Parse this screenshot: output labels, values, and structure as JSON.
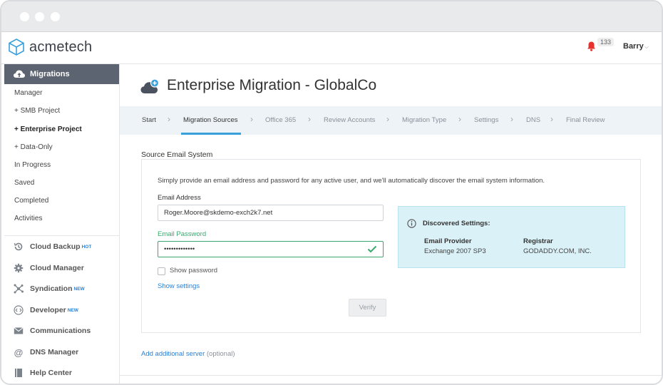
{
  "app": {
    "brand": "acmetech",
    "notification_count": "133",
    "user_name": "Barry"
  },
  "sidebar": {
    "header": "Migrations",
    "sub_items": [
      {
        "label": "Manager",
        "bold": false
      },
      {
        "label": "+ SMB Project",
        "bold": false
      },
      {
        "label": "+ Enterprise Project",
        "bold": true
      },
      {
        "label": "+ Data-Only",
        "bold": false
      },
      {
        "label": "In Progress",
        "bold": false
      },
      {
        "label": "Saved",
        "bold": false
      },
      {
        "label": "Completed",
        "bold": false
      },
      {
        "label": "Activities",
        "bold": false
      }
    ],
    "items": [
      {
        "label": "Cloud Backup",
        "tag": "HOT",
        "icon": "history-icon"
      },
      {
        "label": "Cloud Manager",
        "tag": "",
        "icon": "gear-icon"
      },
      {
        "label": "Syndication",
        "tag": "NEW",
        "icon": "network-icon"
      },
      {
        "label": "Developer",
        "tag": "NEW",
        "icon": "code-icon"
      },
      {
        "label": "Communications",
        "tag": "",
        "icon": "envelope-icon"
      },
      {
        "label": "DNS Manager",
        "tag": "",
        "icon": "at-icon"
      },
      {
        "label": "Help Center",
        "tag": "",
        "icon": "book-icon"
      }
    ]
  },
  "main": {
    "title": "Enterprise Migration - GlobalCo",
    "steps": [
      "Start",
      "Migration Sources",
      "Office 365",
      "Review Accounts",
      "Migration Type",
      "Settings",
      "DNS",
      "Final Review"
    ],
    "active_step": 1,
    "section_title": "Source Email System",
    "intro": "Simply provide an email address and password for any active user, and we'll automatically discover the email system information.",
    "email_label": "Email Address",
    "email_value": "Roger.Moore@skdemo-exch2k7.net",
    "password_label": "Email Password",
    "password_value": "•••••••••••••",
    "show_password": "Show password",
    "show_settings": "Show settings",
    "verify": "Verify",
    "discovered": {
      "title": "Discovered Settings:",
      "provider_label": "Email Provider",
      "provider_value": "Exchange 2007 SP3",
      "registrar_label": "Registrar",
      "registrar_value": "GODADDY.COM, INC."
    },
    "add_server": "Add additional server",
    "add_server_optional": "(optional)"
  },
  "colors": {
    "accent": "#3aa0dc",
    "link": "#2a7fd4",
    "success": "#3aa870",
    "bell": "#e5322d",
    "sidebar_active": "#5b6470",
    "info_bg": "#daf1f7"
  }
}
